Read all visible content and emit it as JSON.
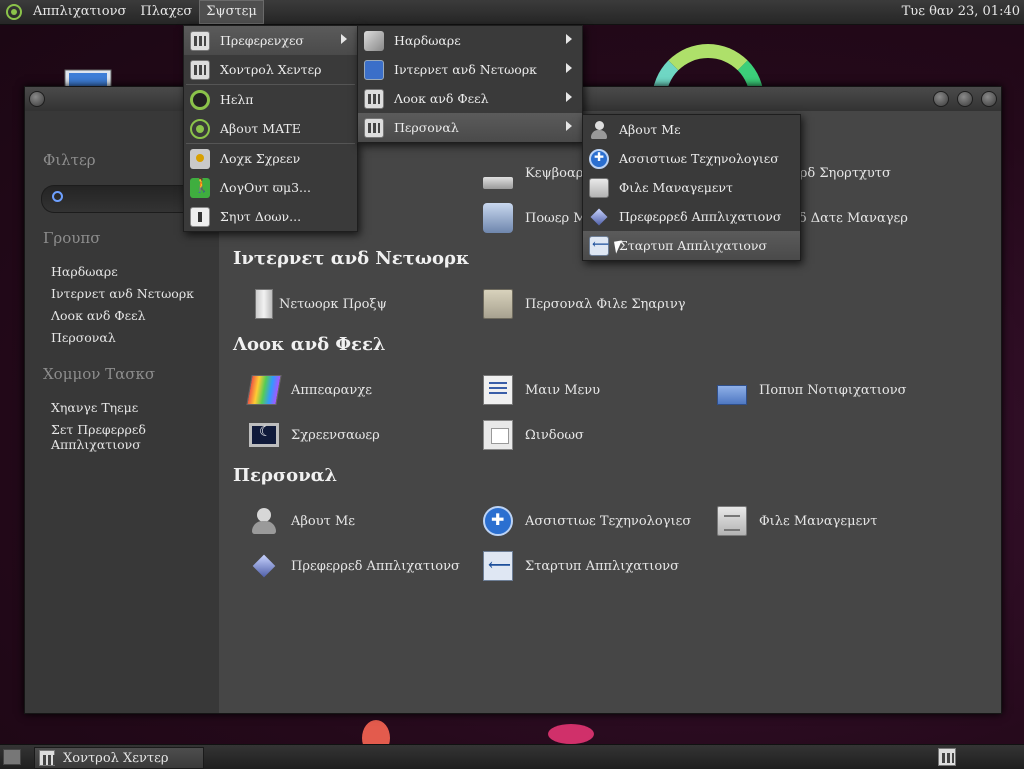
{
  "top_panel": {
    "menus": [
      "Αππλιχατιονσ",
      "Πλαχεσ",
      "Σψστεμ"
    ],
    "clock": "Τυε θαν 23, 01:40"
  },
  "window": {
    "title": "Χοντρολ Χεντερ"
  },
  "sidebar": {
    "filter_heading": "Φιλτερ",
    "groups_heading": "Γρουπσ",
    "groups": [
      "Ηαρδωαρε",
      "Ιντερνετ ανδ Νετωορκ",
      "Λοοκ ανδ Φεελ",
      "Περσοναλ"
    ],
    "common_tasks_heading": "Χομμον Τασκσ",
    "tasks": [
      "Χηανγε Τηεμε",
      "Σετ Πρεφερρεδ Αππλιχατιονσ"
    ]
  },
  "content": {
    "hardware_items": [
      "Κεψβοαρδ",
      "Ποωερ Μαναγεμεντ"
    ],
    "hardware_right": [
      "Κεψβοαρδ Σηορτχυτσ",
      "Τιμε ανδ Δατε Μαναγερ"
    ],
    "internet": {
      "title": "Ιντερνετ ανδ Νετωορκ",
      "items": [
        "Νετωορκ Προξψ",
        "Περσοναλ Φιλε Σηαρινγ"
      ]
    },
    "look": {
      "title": "Λοοκ ανδ Φεελ",
      "items": [
        "Αππεαρανχε",
        "Μαιν Μενυ",
        "Ποπυπ Νοτιφιχατιονσ",
        "Σχρεενσαωερ",
        "Ωινδοωσ"
      ]
    },
    "personal": {
      "title": "Περσοναλ",
      "items": [
        "Αβουτ Με",
        "Ασσιστιωε Τεχηνολογιεσ",
        "Φιλε Μαναγεμεντ",
        "Πρεφερρεδ Αππλιχατιονσ",
        "Σταρτυπ Αππλιχατιονσ"
      ]
    }
  },
  "system_menu": {
    "items": [
      "Πρεφερενχεσ",
      "Χοντρολ Χεντερ",
      "Ηελπ",
      "Αβουτ MATE",
      "Λοχκ Σχρεεν",
      "ΛογΟυτ ϖμ3...",
      "Σηυτ Δοων..."
    ]
  },
  "preferences_menu": {
    "items": [
      "Ηαρδωαρε",
      "Ιντερνετ ανδ Νετωορκ",
      "Λοοκ ανδ Φεελ",
      "Περσοναλ"
    ]
  },
  "personal_menu": {
    "items": [
      "Αβουτ Με",
      "Ασσιστιωε Τεχηνολογιεσ",
      "Φιλε Μαναγεμεντ",
      "Πρεφερρεδ Αππλιχατιονσ",
      "Σταρτυπ Αππλιχατιονσ"
    ]
  },
  "bottom_panel": {
    "task_label": "Χοντρολ Χεντερ"
  },
  "colors": {
    "accent_green": "#8bc34a",
    "panel": "#2c2c2c",
    "content_bg": "#464646"
  }
}
